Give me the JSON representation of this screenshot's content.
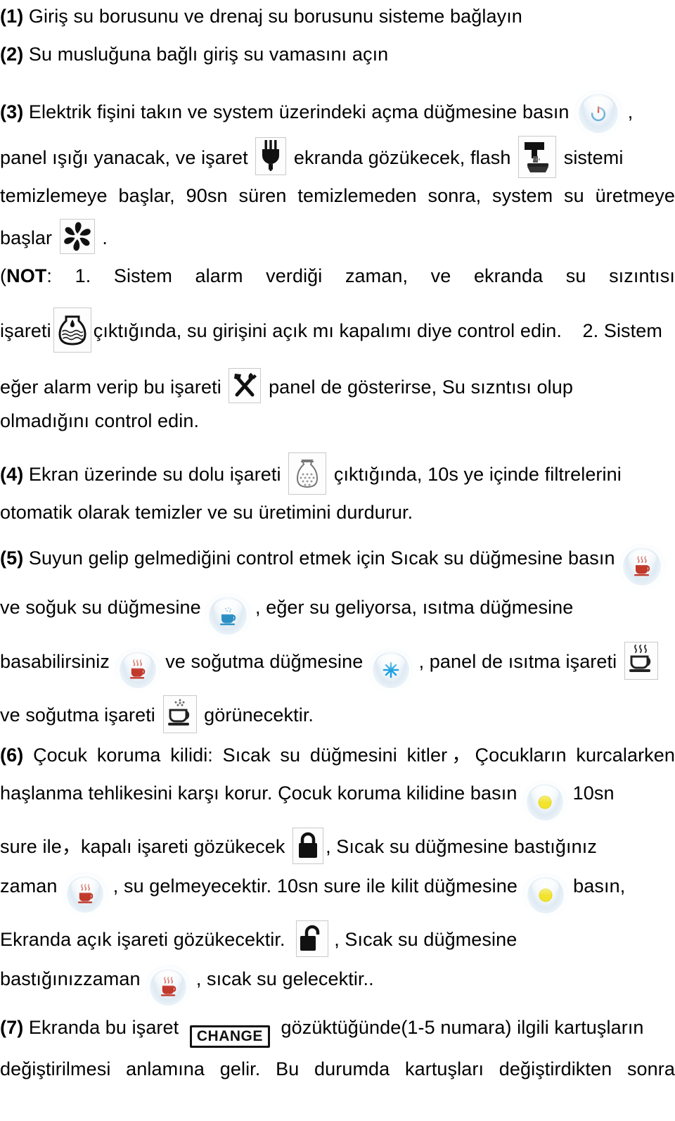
{
  "document": {
    "language": "tr",
    "type": "appliance-instruction-manual-page",
    "text_color": "#000000",
    "background_color": "#ffffff"
  },
  "steps": {
    "s1": {
      "number": "(1)",
      "text": "Giriş su borusunu ve drenaj su borusunu sisteme bağlayın"
    },
    "s2": {
      "number": "(2)",
      "text": "Su musluğuna bağlı giriş su vamasını açın"
    },
    "s3": {
      "number": "(3)",
      "line1": "Elektrik fişini takın ve system üzerindeki açma düğmesine basın",
      "comma_after_power": ",",
      "line2_a": "panel ışığı yanacak, ve işaret",
      "line2_b": "ekranda gözükecek, flash",
      "line2_c": "sistemi",
      "line3": "temizlemeye başlar, 90sn süren temizlemeden sonra, system su üretmeye",
      "line4": "başlar",
      "line4_period": "."
    },
    "note": {
      "open_paren": "(",
      "label": "NOT",
      "colon": ":",
      "item1_num": "1.",
      "item1_a": "Sistem alarm verdiği zaman, ve ekranda su sızıntısı",
      "item1_b": "işareti",
      "item1_c": "çıktığında, su girişini açık mı kapalımı diye control edin.",
      "item2_num": "2. Sistem",
      "item2_a": "eğer alarm verip bu işareti",
      "item2_b": "panel de gösterirse, Su sızntısı olup",
      "item2_c": "olmadığını control edin."
    },
    "s4": {
      "number": "(4)",
      "line1_a": "Ekran üzerinde su dolu işareti",
      "line1_b": "çıktığında, 10s ye içinde filtrelerini",
      "line2": "otomatik olarak temizler ve su üretimini durdurur."
    },
    "s5": {
      "number": "(5)",
      "line1": "Suyun gelip gelmediğini control etmek için Sıcak su düğmesine basın",
      "line2_a": "ve soğuk su düğmesine",
      "line2_b": ", eğer su geliyorsa, ısıtma düğmesine",
      "line3_a": "basabilirsiniz",
      "line3_b": "ve soğutma düğmesine",
      "line3_c": ", panel de ısıtma işareti",
      "line4_a": "ve soğutma işareti",
      "line4_b": "görünecektir."
    },
    "s6": {
      "number": "(6)",
      "line1": "Çocuk koruma kilidi: Sıcak su düğmesini kitler，Çocukların kurcalarken",
      "line2_a": "haşlanma tehlikesini karşı korur.   Çocuk koruma kilidine basın",
      "line2_b": "10sn",
      "line3_a": "sure ile，kapalı işareti gözükecek",
      "line3_b": ",   Sıcak su düğmesine bastığınız",
      "line4_a": "zaman",
      "line4_b": ", su gelmeyecektir. 10sn sure ile kilit düğmesine",
      "line4_c": "basın,",
      "line5_a": "Ekranda açık işareti gözükecektir.",
      "line5_b": ",      Sıcak su düğmesine",
      "line6_a": "bastığınızzaman",
      "line6_b": ", sıcak su gelecektir.."
    },
    "s7": {
      "number": "(7)",
      "line1_a": "Ekranda bu işaret",
      "line1_b": "gözüktüğünde(1-5 numara) ilgili kartuşların",
      "line2": "değiştirilmesi anlamına gelir.   Bu durumda kartuşları değiştirdikten sonra"
    }
  },
  "icons": {
    "power_button": {
      "name": "power-button-icon",
      "label": "güç düğmesi",
      "accent": "#d64b3e"
    },
    "plug": {
      "name": "power-plug-icon",
      "label": "elektrik fişi",
      "accent": "#1a1a1a"
    },
    "faucet": {
      "name": "faucet-flush-icon",
      "label": "musluk / flash",
      "accent": "#1a1a1a"
    },
    "pinwheel": {
      "name": "pinwheel-icon",
      "label": "su üretimi çiçeği",
      "accent": "#1a1a1a"
    },
    "jug_leak": {
      "name": "water-leak-jug-icon",
      "label": "su sızıntısı sürahi",
      "accent": "#1a1a1a"
    },
    "tools": {
      "name": "tools-wrench-hammer-icon",
      "label": "servis / arıza",
      "accent": "#1a1a1a"
    },
    "jug_full": {
      "name": "water-full-jug-icon",
      "label": "su dolu",
      "accent": "#555555"
    },
    "hot_water_button": {
      "name": "hot-water-button-icon",
      "label": "sıcak su düğmesi",
      "accent": "#c0392b"
    },
    "cold_water_button": {
      "name": "cold-water-button-icon",
      "label": "soğuk su düğmesi",
      "accent": "#2b8fc4"
    },
    "heating_button": {
      "name": "heating-button-icon",
      "label": "ısıtma düğmesi",
      "accent": "#c0392b"
    },
    "cooling_button": {
      "name": "cooling-snowflake-button-icon",
      "label": "soğutma düğmesi",
      "accent": "#1fa0e0"
    },
    "heating_panel": {
      "name": "heating-cup-panel-icon",
      "label": "panel ısıtma işareti",
      "accent": "#3a3a3a"
    },
    "cooling_panel": {
      "name": "cooling-cup-panel-icon",
      "label": "panel soğutma işareti",
      "accent": "#3a3a3a"
    },
    "child_lock_button": {
      "name": "child-lock-button-icon",
      "label": "çocuk koruma kilidi düğmesi",
      "accent": "#f2e42c"
    },
    "lock_closed": {
      "name": "lock-closed-icon",
      "label": "kapalı işareti",
      "accent": "#1a1a1a"
    },
    "lock_open": {
      "name": "lock-open-icon",
      "label": "açık işareti",
      "accent": "#1a1a1a"
    },
    "change": {
      "name": "change-badge-icon",
      "label": "CHANGE",
      "text": "CHANGE",
      "accent": "#1a1a1a"
    }
  }
}
